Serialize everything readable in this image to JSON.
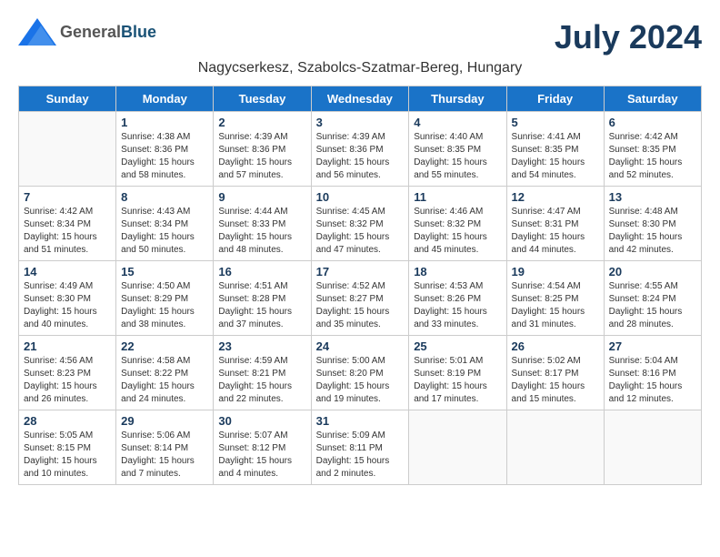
{
  "logo": {
    "general": "General",
    "blue": "Blue"
  },
  "title": "July 2024",
  "subtitle": "Nagycserkesz, Szabolcs-Szatmar-Bereg, Hungary",
  "days_of_week": [
    "Sunday",
    "Monday",
    "Tuesday",
    "Wednesday",
    "Thursday",
    "Friday",
    "Saturday"
  ],
  "weeks": [
    [
      {
        "day": "",
        "info": ""
      },
      {
        "day": "1",
        "info": "Sunrise: 4:38 AM\nSunset: 8:36 PM\nDaylight: 15 hours\nand 58 minutes."
      },
      {
        "day": "2",
        "info": "Sunrise: 4:39 AM\nSunset: 8:36 PM\nDaylight: 15 hours\nand 57 minutes."
      },
      {
        "day": "3",
        "info": "Sunrise: 4:39 AM\nSunset: 8:36 PM\nDaylight: 15 hours\nand 56 minutes."
      },
      {
        "day": "4",
        "info": "Sunrise: 4:40 AM\nSunset: 8:35 PM\nDaylight: 15 hours\nand 55 minutes."
      },
      {
        "day": "5",
        "info": "Sunrise: 4:41 AM\nSunset: 8:35 PM\nDaylight: 15 hours\nand 54 minutes."
      },
      {
        "day": "6",
        "info": "Sunrise: 4:42 AM\nSunset: 8:35 PM\nDaylight: 15 hours\nand 52 minutes."
      }
    ],
    [
      {
        "day": "7",
        "info": "Sunrise: 4:42 AM\nSunset: 8:34 PM\nDaylight: 15 hours\nand 51 minutes."
      },
      {
        "day": "8",
        "info": "Sunrise: 4:43 AM\nSunset: 8:34 PM\nDaylight: 15 hours\nand 50 minutes."
      },
      {
        "day": "9",
        "info": "Sunrise: 4:44 AM\nSunset: 8:33 PM\nDaylight: 15 hours\nand 48 minutes."
      },
      {
        "day": "10",
        "info": "Sunrise: 4:45 AM\nSunset: 8:32 PM\nDaylight: 15 hours\nand 47 minutes."
      },
      {
        "day": "11",
        "info": "Sunrise: 4:46 AM\nSunset: 8:32 PM\nDaylight: 15 hours\nand 45 minutes."
      },
      {
        "day": "12",
        "info": "Sunrise: 4:47 AM\nSunset: 8:31 PM\nDaylight: 15 hours\nand 44 minutes."
      },
      {
        "day": "13",
        "info": "Sunrise: 4:48 AM\nSunset: 8:30 PM\nDaylight: 15 hours\nand 42 minutes."
      }
    ],
    [
      {
        "day": "14",
        "info": "Sunrise: 4:49 AM\nSunset: 8:30 PM\nDaylight: 15 hours\nand 40 minutes."
      },
      {
        "day": "15",
        "info": "Sunrise: 4:50 AM\nSunset: 8:29 PM\nDaylight: 15 hours\nand 38 minutes."
      },
      {
        "day": "16",
        "info": "Sunrise: 4:51 AM\nSunset: 8:28 PM\nDaylight: 15 hours\nand 37 minutes."
      },
      {
        "day": "17",
        "info": "Sunrise: 4:52 AM\nSunset: 8:27 PM\nDaylight: 15 hours\nand 35 minutes."
      },
      {
        "day": "18",
        "info": "Sunrise: 4:53 AM\nSunset: 8:26 PM\nDaylight: 15 hours\nand 33 minutes."
      },
      {
        "day": "19",
        "info": "Sunrise: 4:54 AM\nSunset: 8:25 PM\nDaylight: 15 hours\nand 31 minutes."
      },
      {
        "day": "20",
        "info": "Sunrise: 4:55 AM\nSunset: 8:24 PM\nDaylight: 15 hours\nand 28 minutes."
      }
    ],
    [
      {
        "day": "21",
        "info": "Sunrise: 4:56 AM\nSunset: 8:23 PM\nDaylight: 15 hours\nand 26 minutes."
      },
      {
        "day": "22",
        "info": "Sunrise: 4:58 AM\nSunset: 8:22 PM\nDaylight: 15 hours\nand 24 minutes."
      },
      {
        "day": "23",
        "info": "Sunrise: 4:59 AM\nSunset: 8:21 PM\nDaylight: 15 hours\nand 22 minutes."
      },
      {
        "day": "24",
        "info": "Sunrise: 5:00 AM\nSunset: 8:20 PM\nDaylight: 15 hours\nand 19 minutes."
      },
      {
        "day": "25",
        "info": "Sunrise: 5:01 AM\nSunset: 8:19 PM\nDaylight: 15 hours\nand 17 minutes."
      },
      {
        "day": "26",
        "info": "Sunrise: 5:02 AM\nSunset: 8:17 PM\nDaylight: 15 hours\nand 15 minutes."
      },
      {
        "day": "27",
        "info": "Sunrise: 5:04 AM\nSunset: 8:16 PM\nDaylight: 15 hours\nand 12 minutes."
      }
    ],
    [
      {
        "day": "28",
        "info": "Sunrise: 5:05 AM\nSunset: 8:15 PM\nDaylight: 15 hours\nand 10 minutes."
      },
      {
        "day": "29",
        "info": "Sunrise: 5:06 AM\nSunset: 8:14 PM\nDaylight: 15 hours\nand 7 minutes."
      },
      {
        "day": "30",
        "info": "Sunrise: 5:07 AM\nSunset: 8:12 PM\nDaylight: 15 hours\nand 4 minutes."
      },
      {
        "day": "31",
        "info": "Sunrise: 5:09 AM\nSunset: 8:11 PM\nDaylight: 15 hours\nand 2 minutes."
      },
      {
        "day": "",
        "info": ""
      },
      {
        "day": "",
        "info": ""
      },
      {
        "day": "",
        "info": ""
      }
    ]
  ]
}
